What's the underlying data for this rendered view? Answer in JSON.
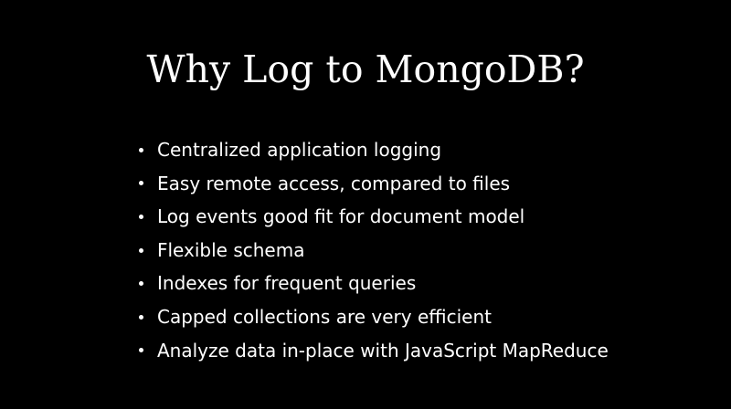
{
  "slide": {
    "title": "Why Log to MongoDB?",
    "bullets": [
      "Centralized application logging",
      "Easy remote access, compared to files",
      "Log events good fit for document model",
      "Flexible schema",
      "Indexes for frequent queries",
      "Capped collections are very efficient",
      "Analyze data in-place with JavaScript MapReduce"
    ]
  }
}
